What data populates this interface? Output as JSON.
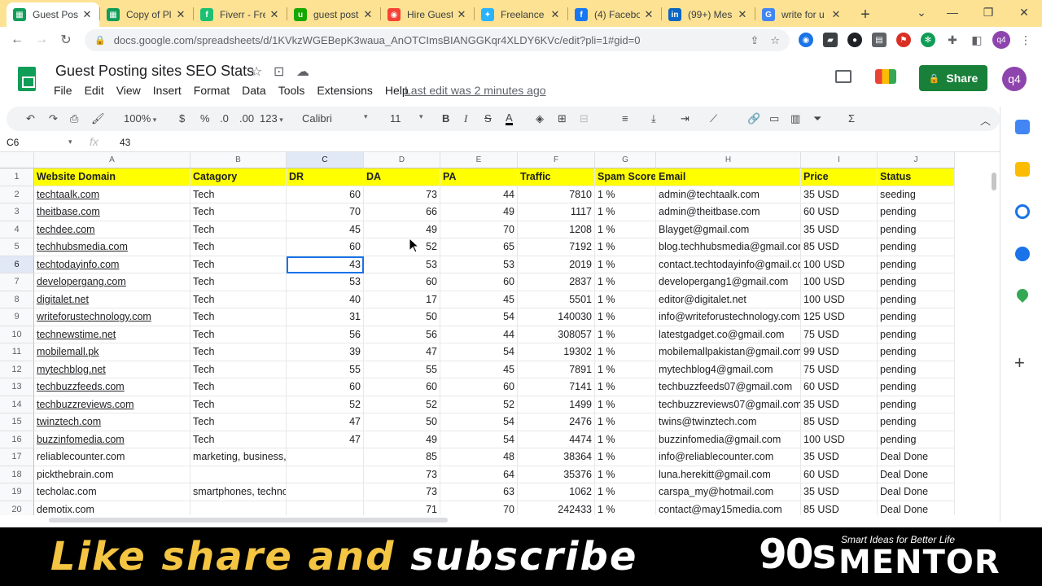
{
  "browser": {
    "tabs": [
      {
        "title": "Guest Posti",
        "color": "#0f9d58",
        "glyph": "▦",
        "active": true
      },
      {
        "title": "Copy of Pl",
        "color": "#0f9d58",
        "glyph": "▦",
        "active": false
      },
      {
        "title": "Fiverr - Fre",
        "color": "#1dbf73",
        "glyph": "f",
        "active": false
      },
      {
        "title": "guest post",
        "color": "#14a800",
        "glyph": "u",
        "active": false
      },
      {
        "title": "Hire Guest",
        "color": "#f44336",
        "glyph": "◉",
        "active": false
      },
      {
        "title": "Freelance",
        "color": "#29b2fe",
        "glyph": "✦",
        "active": false
      },
      {
        "title": "(4) Facebo",
        "color": "#1877f2",
        "glyph": "f",
        "active": false
      },
      {
        "title": "(99+) Mes",
        "color": "#0a66c2",
        "glyph": "in",
        "active": false
      },
      {
        "title": "write for u",
        "color": "#4285f4",
        "glyph": "G",
        "active": false
      }
    ],
    "url": "docs.google.com/spreadsheets/d/1KVkzWGEBepK3waua_AnOTCImsBIANGGKqr4XLDY6KVc/edit?pli=1#gid=0"
  },
  "sheet": {
    "title": "Guest Posting sites SEO Stats",
    "menu": [
      "File",
      "Edit",
      "View",
      "Insert",
      "Format",
      "Data",
      "Tools",
      "Extensions",
      "Help"
    ],
    "last_edit": "Last edit was 2 minutes ago",
    "share_label": "Share",
    "avatar_label": "q4"
  },
  "toolbar": {
    "zoom": "100%",
    "currency": "$",
    "percent": "%",
    "dec_less": ".0",
    "dec_more": ".00",
    "format_more": "123",
    "font": "Calibri",
    "font_size": "11",
    "bold": "B",
    "italic": "I",
    "strike": "S",
    "text_color": "A"
  },
  "formula_bar": {
    "cell_ref": "C6",
    "fx": "fx",
    "value": "43"
  },
  "columns": [
    "A",
    "B",
    "C",
    "D",
    "E",
    "F",
    "G",
    "H",
    "I",
    "J"
  ],
  "header_row": [
    "Website Domain",
    "Catagory",
    "DR",
    "DA",
    "PA",
    "Traffic",
    "Spam Score",
    "Email",
    "Price",
    "Status"
  ],
  "rows": [
    [
      "techtaalk.com",
      "Tech",
      "60",
      "73",
      "44",
      "7810",
      "1 %",
      "admin@techtaalk.com",
      "35 USD",
      "seeding"
    ],
    [
      "theitbase.com",
      "Tech",
      "70",
      "66",
      "49",
      "1117",
      "1 %",
      "admin@theitbase.com",
      "60 USD",
      "pending"
    ],
    [
      "techdee.com",
      "Tech",
      "45",
      "49",
      "70",
      "1208",
      "1 %",
      "Blayget@gmail.com",
      "35 USD",
      "pending"
    ],
    [
      "techhubsmedia.com",
      "Tech",
      "60",
      "52",
      "65",
      "7192",
      "1 %",
      "blog.techhubsmedia@gmail.com",
      "85 USD",
      "pending"
    ],
    [
      "techtodayinfo.com",
      "Tech",
      "43",
      "53",
      "53",
      "2019",
      "1 %",
      "contact.techtodayinfo@gmail.com",
      "100 USD",
      "pending"
    ],
    [
      "developergang.com",
      "Tech",
      "53",
      "60",
      "60",
      "2837",
      "1 %",
      "developergang1@gmail.com",
      "100 USD",
      "pending"
    ],
    [
      "digitalet.net",
      "Tech",
      "40",
      "17",
      "45",
      "5501",
      "1 %",
      "editor@digitalet.net",
      "100 USD",
      "pending"
    ],
    [
      "writeforustechnology.com",
      "Tech",
      "31",
      "50",
      "54",
      "140030",
      "1 %",
      "info@writeforustechnology.com",
      "125 USD",
      "pending"
    ],
    [
      "technewstime.net",
      "Tech",
      "56",
      "56",
      "44",
      "308057",
      "1 %",
      "latestgadget.co@gmail.com",
      "75 USD",
      "pending"
    ],
    [
      "mobilemall.pk",
      "Tech",
      "39",
      "47",
      "54",
      "19302",
      "1 %",
      "mobilemallpakistan@gmail.com",
      "99 USD",
      "pending"
    ],
    [
      "mytechblog.net",
      "Tech",
      "55",
      "55",
      "45",
      "7891",
      "1 %",
      "mytechblog4@gmail.com",
      "75 USD",
      "pending"
    ],
    [
      "techbuzzfeeds.com",
      "Tech",
      "60",
      "60",
      "60",
      "7141",
      "1 %",
      "techbuzzfeeds07@gmail.com",
      "60 USD",
      "pending"
    ],
    [
      "techbuzzreviews.com",
      "Tech",
      "52",
      "52",
      "52",
      "1499",
      "1 %",
      "techbuzzreviews07@gmail.com",
      "35 USD",
      "pending"
    ],
    [
      "twinztech.com",
      "Tech",
      "47",
      "50",
      "54",
      "2476",
      "1 %",
      "twins@twinztech.com",
      "85 USD",
      "pending"
    ],
    [
      "buzzinfomedia.com",
      "Tech",
      "47",
      "49",
      "54",
      "4474",
      "1 %",
      "buzzinfomedia@gmail.com",
      "100 USD",
      "pending"
    ],
    [
      "reliablecounter.com",
      "marketing, business, seo",
      "",
      "85",
      "48",
      "38364",
      "1 %",
      "info@reliablecounter.com",
      "35 USD",
      "Deal Done"
    ],
    [
      "pickthebrain.com",
      "",
      "",
      "73",
      "64",
      "35376",
      "1 %",
      "luna.herekitt@gmail.com",
      "60 USD",
      "Deal Done"
    ],
    [
      "techolac.com",
      "smartphones, technology",
      "",
      "73",
      "63",
      "1062",
      "1 %",
      "carspa_my@hotmail.com",
      "35 USD",
      "Deal Done"
    ],
    [
      "demotix.com",
      "",
      "",
      "71",
      "70",
      "242433",
      "1 %",
      "contact@may15media.com",
      "85 USD",
      "Deal Done"
    ]
  ],
  "banner": {
    "part1": "Like share and",
    "part2": "subscribe",
    "brand_num": "90s",
    "brand_word": "MENTOR",
    "brand_tag": "Smart Ideas for Better Life"
  }
}
